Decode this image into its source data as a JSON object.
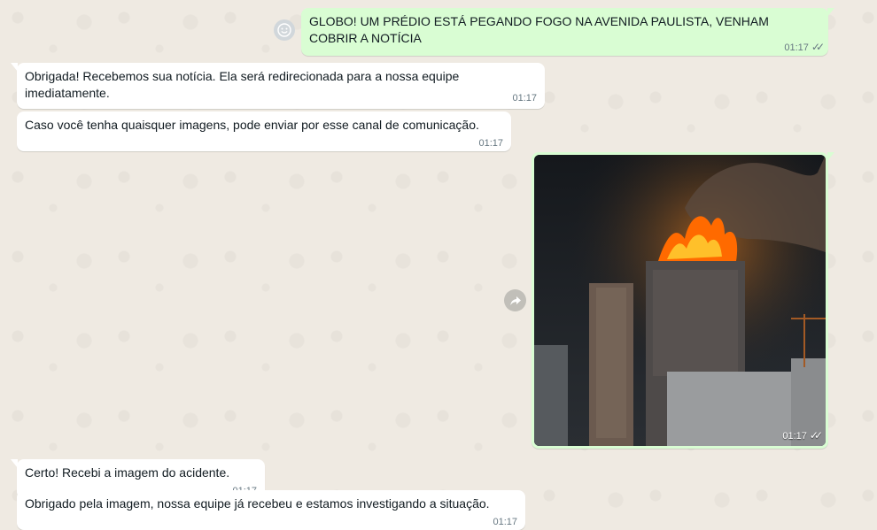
{
  "messages": [
    {
      "text": "GLOBO! UM PRÉDIO ESTÁ PEGANDO FOGO NA AVENIDA PAULISTA, VENHAM COBRIR A NOTÍCIA",
      "time": "01:17"
    },
    {
      "text": "Obrigada! Recebemos sua notícia. Ela será redirecionada para a nossa equipe imediatamente.",
      "time": "01:17"
    },
    {
      "text": "Caso você tenha quaisquer imagens, pode enviar por esse canal de comunicação.",
      "time": "01:17"
    },
    {
      "time": "01:17"
    },
    {
      "text": "Certo! Recebi a imagem do acidente.",
      "time": "01:17"
    },
    {
      "text": "Obrigado pela imagem, nossa equipe já recebeu e estamos investigando a situação.",
      "time": "01:17"
    }
  ],
  "icons": {
    "emoji": "smiley-icon",
    "forward": "forward-icon",
    "read_receipt": "double-check-icon"
  },
  "colors": {
    "incoming": "#ffffff",
    "outgoing": "#d9fdd3",
    "background": "#efeae2"
  }
}
